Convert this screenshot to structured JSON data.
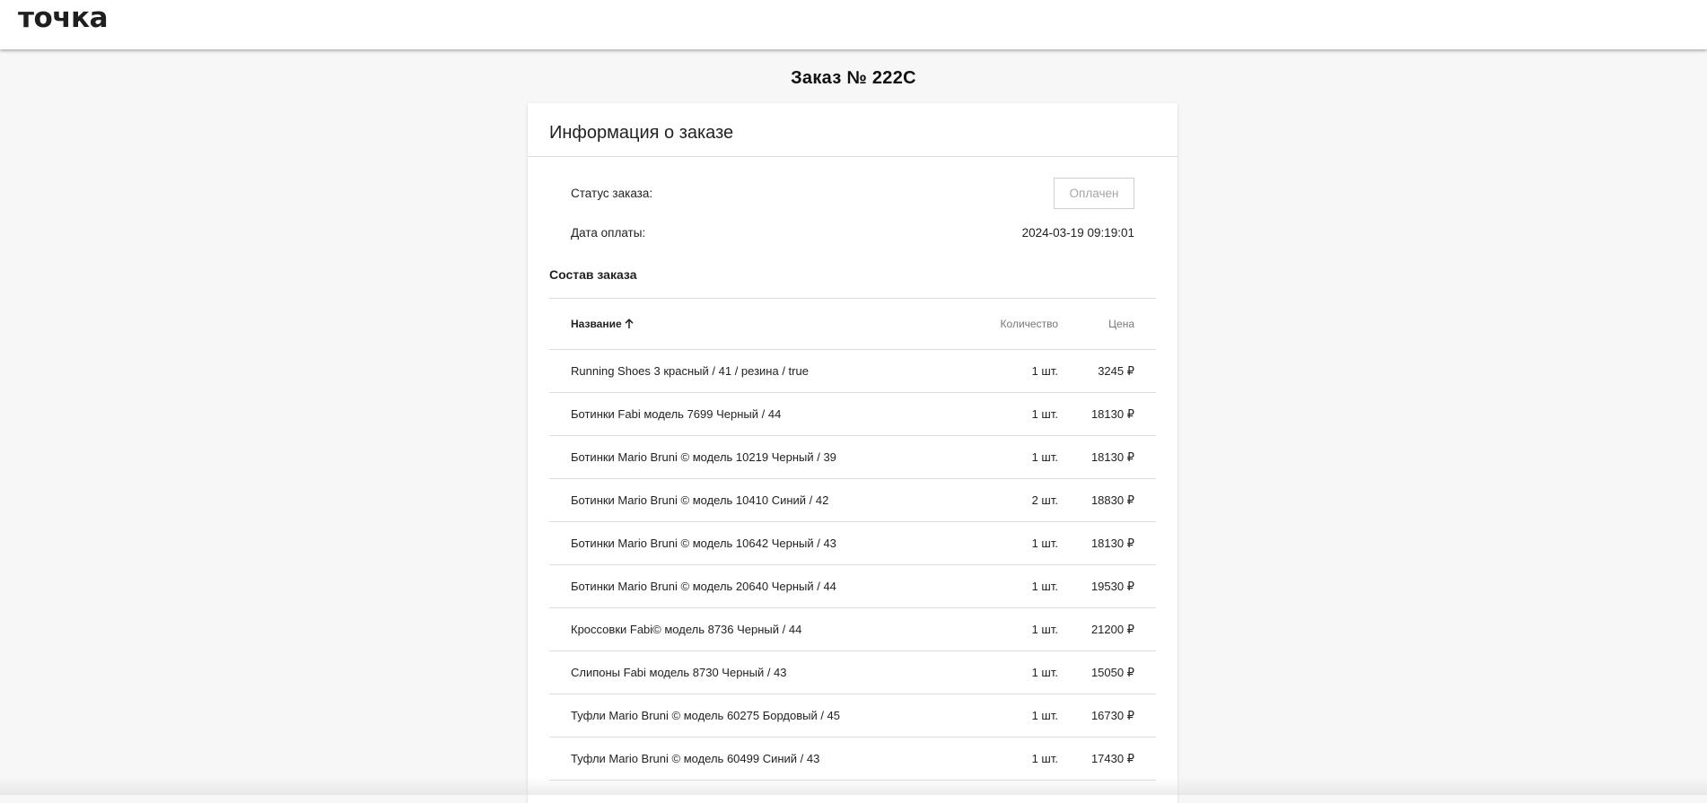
{
  "header": {
    "logo": "точка"
  },
  "page_title": "Заказ № 222С",
  "card": {
    "title": "Информация о заказе",
    "status_label": "Статус заказа:",
    "status_value": "Оплачен",
    "payment_date_label": "Дата оплаты:",
    "payment_date_value": "2024-03-19 09:19:01",
    "section_title": "Состав заказа"
  },
  "table": {
    "columns": {
      "name": "Название",
      "qty": "Количество",
      "price": "Цена"
    },
    "rows": [
      {
        "name": "Running Shoes 3 красный / 41 / резина / true",
        "qty": "1 шт.",
        "price": "3245 ₽"
      },
      {
        "name": "Ботинки Fabi модель 7699 Черный / 44",
        "qty": "1 шт.",
        "price": "18130 ₽"
      },
      {
        "name": "Ботинки Mario Bruni © модель 10219 Черный / 39",
        "qty": "1 шт.",
        "price": "18130 ₽"
      },
      {
        "name": "Ботинки Mario Bruni © модель 10410 Синий / 42",
        "qty": "2 шт.",
        "price": "18830 ₽"
      },
      {
        "name": "Ботинки Mario Bruni © модель 10642 Черный / 43",
        "qty": "1 шт.",
        "price": "18130 ₽"
      },
      {
        "name": "Ботинки Mario Bruni © модель 20640 Черный / 44",
        "qty": "1 шт.",
        "price": "19530 ₽"
      },
      {
        "name": "Кроссовки Fabi© модель 8736 Черный / 44",
        "qty": "1 шт.",
        "price": "21200 ₽"
      },
      {
        "name": "Слипоны Fabi модель 8730 Черный / 43",
        "qty": "1 шт.",
        "price": "15050 ₽"
      },
      {
        "name": "Туфли Mario Bruni © модель 60275 Бордовый / 45",
        "qty": "1 шт.",
        "price": "16730 ₽"
      },
      {
        "name": "Туфли Mario Bruni © модель 60499 Синий / 43",
        "qty": "1 шт.",
        "price": "17430 ₽"
      }
    ]
  },
  "icons": {
    "sort": "arrow-up-icon"
  },
  "colors": {
    "background": "#f7f7f7",
    "card": "#ffffff",
    "border": "#dcdcdc",
    "status_text": "#a6a6a6"
  }
}
